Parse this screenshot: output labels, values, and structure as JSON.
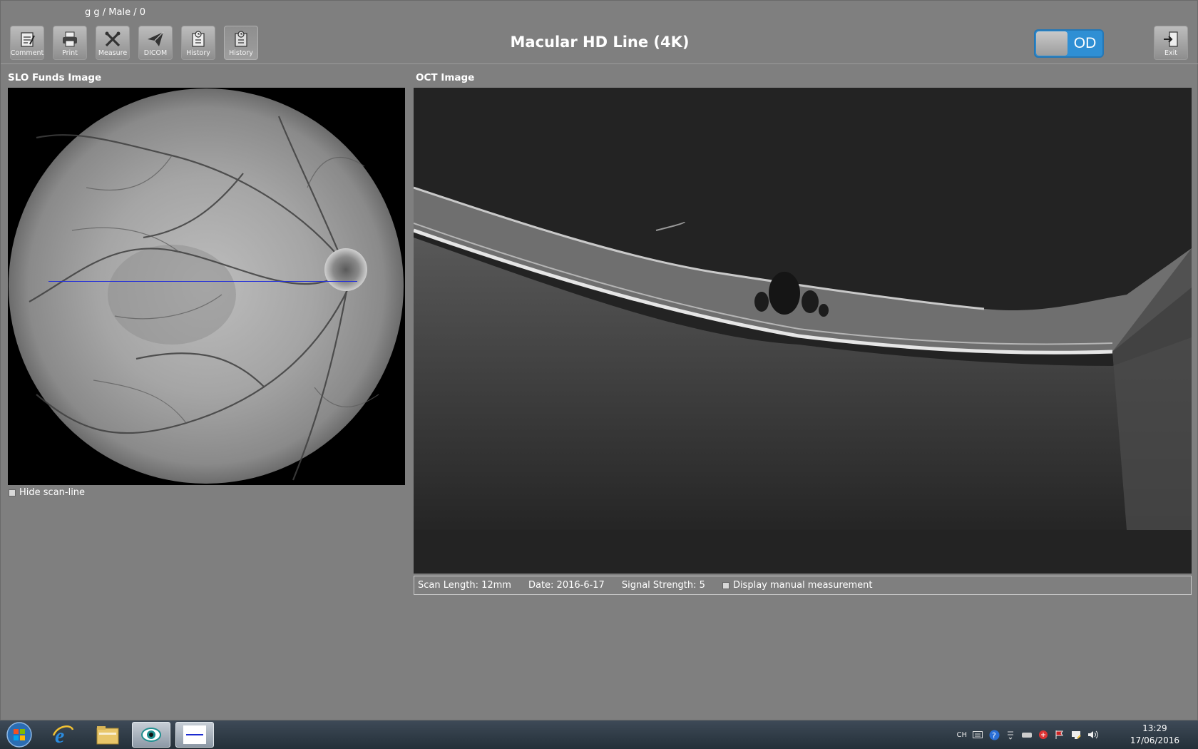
{
  "patient": {
    "info": "g  g  / Male / 0"
  },
  "toolbar": {
    "buttons": [
      {
        "label": "Comment",
        "icon": "comment-icon"
      },
      {
        "label": "Print",
        "icon": "printer-icon"
      },
      {
        "label": "Measure",
        "icon": "measure-icon"
      },
      {
        "label": "DICOM",
        "icon": "send-icon"
      },
      {
        "label": "History",
        "icon": "history-icon"
      },
      {
        "label": "History",
        "icon": "history-icon",
        "active": true
      }
    ],
    "exit_label": "Exit"
  },
  "title": "Macular HD Line (4K)",
  "eye_toggle": {
    "label": "OD",
    "color": "#2f8fd4"
  },
  "slo": {
    "title": "SLO Funds Image",
    "hide_scanline_label": "Hide scan-line",
    "scanline_color": "#2430d8"
  },
  "oct": {
    "title": "OCT Image",
    "scan_length": "Scan Length: 12mm",
    "date": "Date: 2016-6-17",
    "signal_strength": "Signal Strength: 5",
    "manual_measurement_label": "Display manual measurement"
  },
  "taskbar": {
    "apps": [
      "start-orb-icon",
      "internet-explorer-icon",
      "file-explorer-icon",
      "oct-app-icon",
      "scan-viewer-icon"
    ],
    "tray_lang": "CH",
    "time": "13:29",
    "date": "17/06/2016"
  }
}
